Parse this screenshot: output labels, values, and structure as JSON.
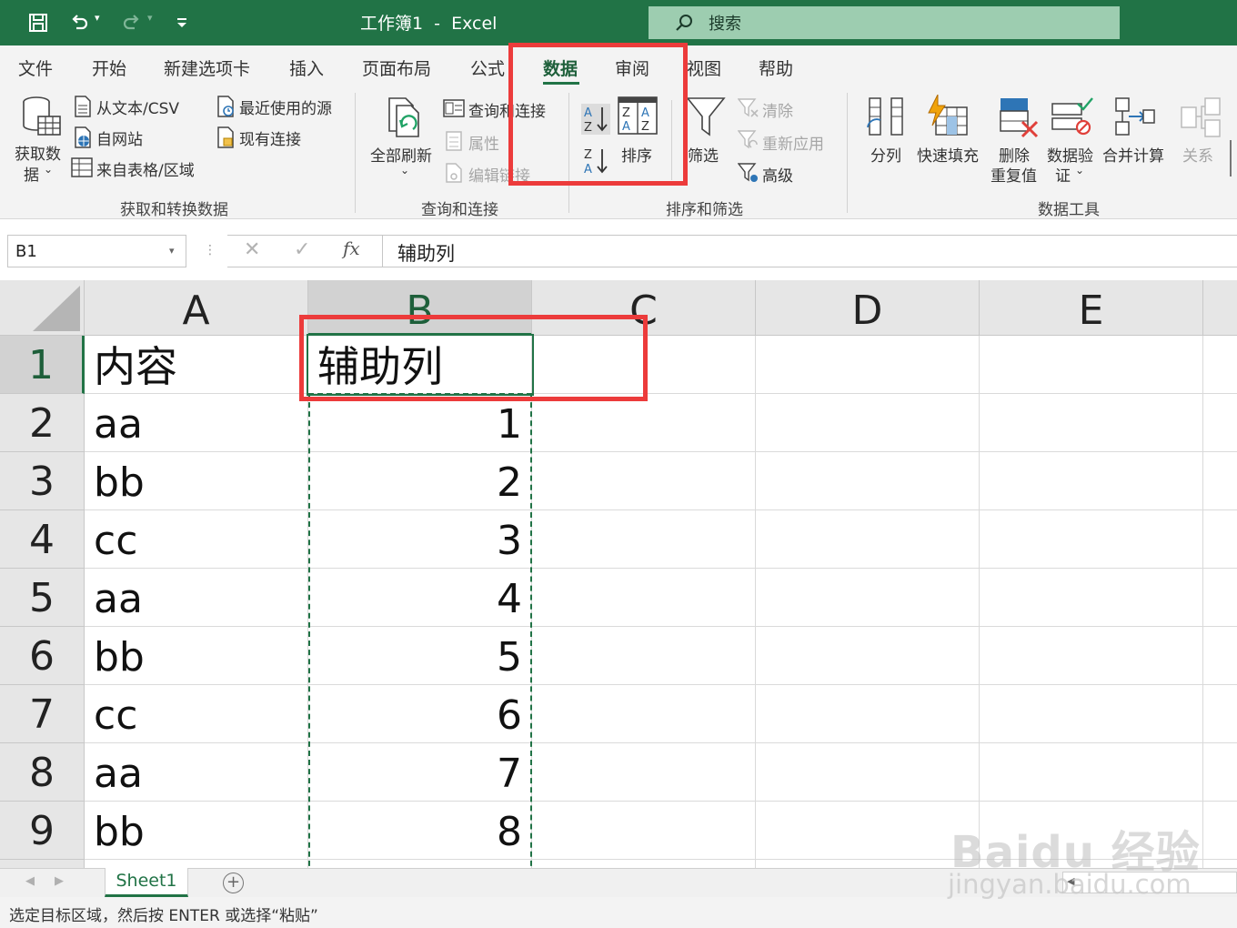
{
  "titlebar": {
    "title": "工作簿1  -  Excel",
    "search_placeholder": "搜索"
  },
  "ribbon_tabs": [
    "文件",
    "开始",
    "新建选项卡",
    "插入",
    "页面布局",
    "公式",
    "数据",
    "审阅",
    "视图",
    "帮助"
  ],
  "active_tab": "数据",
  "ribbon": {
    "get_transform": {
      "get_data": [
        "获取数",
        "据"
      ],
      "from_text_csv": "从文本/CSV",
      "from_web": "自网站",
      "from_table_range": "来自表格/区域",
      "recent_sources": "最近使用的源",
      "existing_connections": "现有连接",
      "group_label": "获取和转换数据"
    },
    "queries": {
      "refresh_all": "全部刷新",
      "queries_connections": "查询和连接",
      "properties": "属性",
      "edit_links": "编辑链接",
      "group_label": "查询和连接"
    },
    "sort_filter": {
      "sort": "排序",
      "filter": "筛选",
      "clear": "清除",
      "reapply": "重新应用",
      "advanced": "高级",
      "group_label": "排序和筛选"
    },
    "data_tools": {
      "text_to_columns": "分列",
      "flash_fill": "快速填充",
      "remove_duplicates": [
        "删除",
        "重复值"
      ],
      "data_validation": [
        "数据验",
        "证"
      ],
      "consolidate": "合并计算",
      "relationships": "关系",
      "group_label": "数据工具"
    }
  },
  "formula_bar": {
    "name_box": "B1",
    "fx": "fx",
    "formula": "辅助列"
  },
  "columns": [
    "A",
    "B",
    "C",
    "D",
    "E"
  ],
  "selected_column": "B",
  "rows": [
    {
      "n": "1",
      "a": "内容",
      "b": "辅助列"
    },
    {
      "n": "2",
      "a": "aa",
      "b": "1"
    },
    {
      "n": "3",
      "a": "bb",
      "b": "2"
    },
    {
      "n": "4",
      "a": "cc",
      "b": "3"
    },
    {
      "n": "5",
      "a": "aa",
      "b": "4"
    },
    {
      "n": "6",
      "a": "bb",
      "b": "5"
    },
    {
      "n": "7",
      "a": "cc",
      "b": "6"
    },
    {
      "n": "8",
      "a": "aa",
      "b": "7"
    },
    {
      "n": "9",
      "a": "bb",
      "b": "8"
    }
  ],
  "sheet_tabs": [
    "Sheet1"
  ],
  "status": "选定目标区域，然后按 ENTER 或选择“粘贴”",
  "watermark": {
    "logo": "Baidu 经验",
    "url": "jingyan.baidu.com"
  },
  "colors": {
    "excel_green": "#217346",
    "highlight_red": "#ec3b3b"
  }
}
